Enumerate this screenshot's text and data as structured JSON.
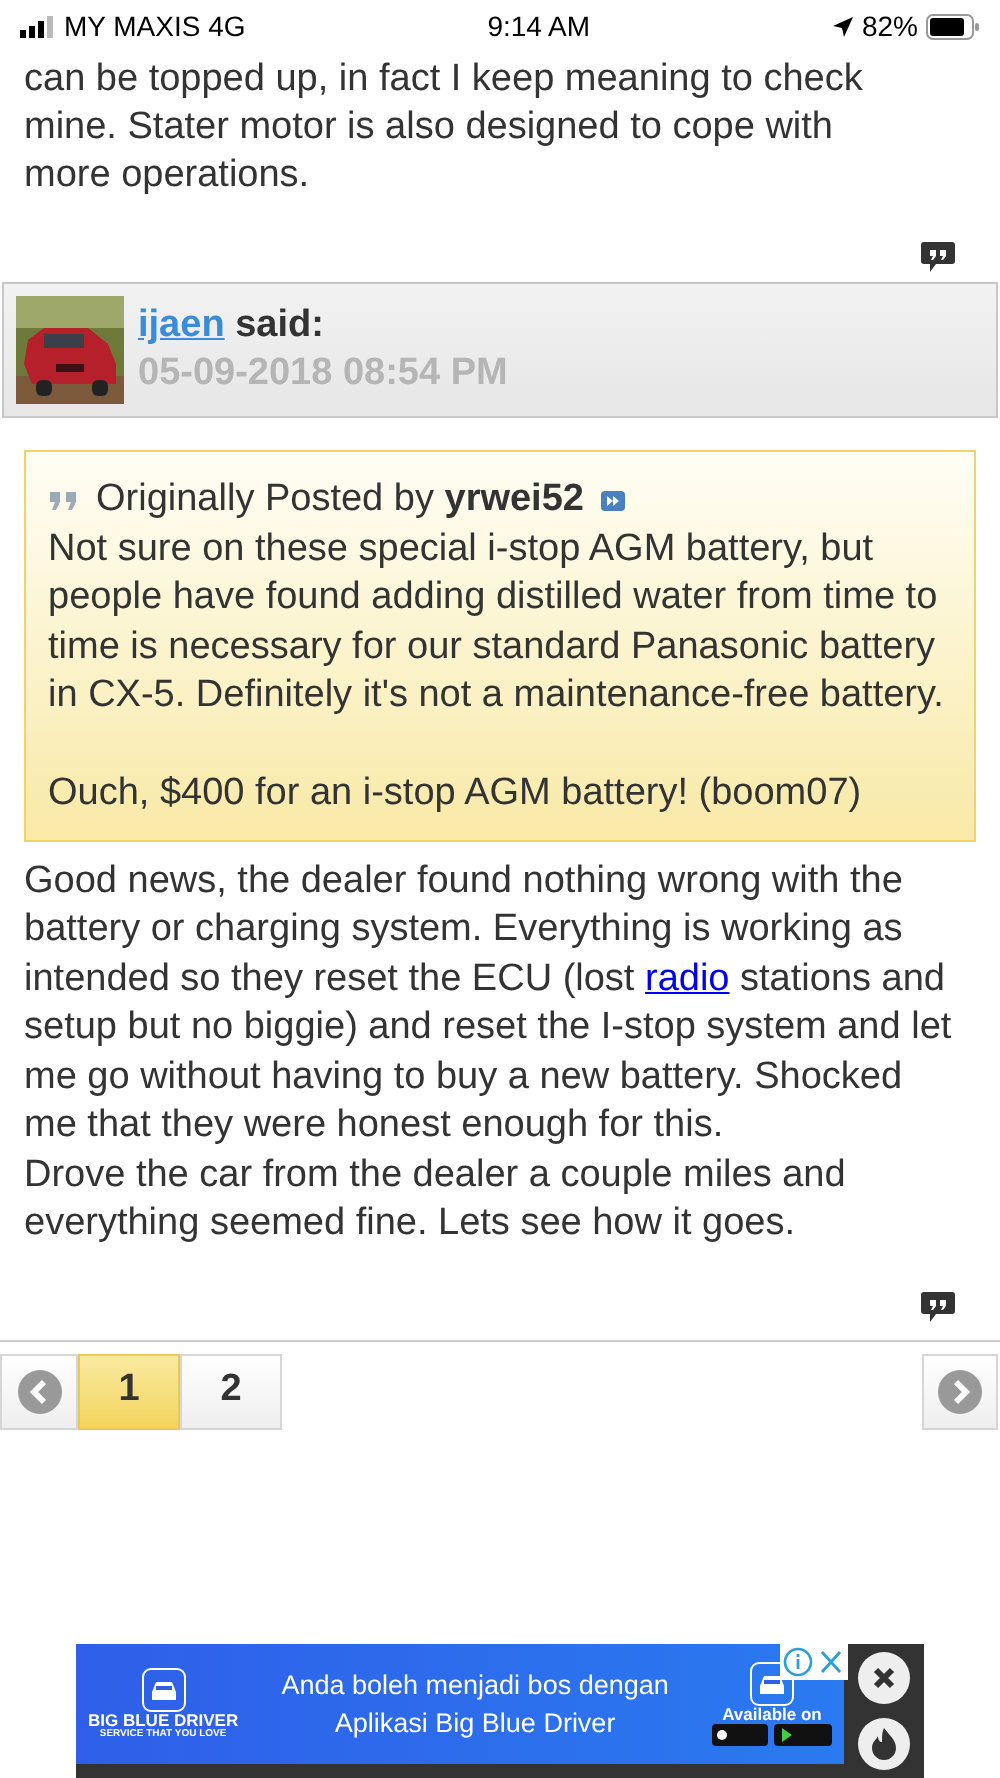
{
  "status_bar": {
    "carrier": "MY MAXIS 4G",
    "time": "9:14 AM",
    "battery": "82%"
  },
  "previous_post": {
    "text": "can be topped up, in fact I keep meaning to check mine. Stater motor is also designed to cope with more operations."
  },
  "post": {
    "author": "ijaen",
    "said": "said:",
    "date": "05-09-2018 08:54 PM",
    "quote": {
      "intro": "Originally Posted by",
      "author": "yrwei52",
      "paragraphs": [
        "Not sure on these special i-stop AGM battery, but people have found adding distilled water from time to time is necessary for our standard Panasonic battery in CX-5. Definitely it's not a maintenance-free battery.",
        "Ouch, $400 for an i-stop AGM battery! (boom07)"
      ]
    },
    "body": [
      {
        "kind": "text",
        "text": "Good news, the dealer found nothing wrong with the battery or charging system. Everything is working as intended so they reset the ECU (lost "
      },
      {
        "kind": "link",
        "text": "radio"
      },
      {
        "kind": "text",
        "text": " stations and setup but no biggie) and reset the I-stop system and let me go without having to buy a new battery. Shocked me that they were honest enough for this."
      },
      {
        "kind": "break"
      },
      {
        "kind": "text",
        "text": "Drove the car from the dealer a couple miles and everything seemed fine. Lets see how it goes."
      }
    ]
  },
  "pagination": {
    "pages": [
      {
        "label": "1",
        "selected": true
      },
      {
        "label": "2",
        "selected": false
      }
    ]
  },
  "ad": {
    "brand": "BIG BLUE DRIVER",
    "tagline": "SERVICE THAT YOU LOVE",
    "headline": "Anda boleh menjadi bos dengan Aplikasi Big Blue Driver",
    "available": "Available on"
  }
}
